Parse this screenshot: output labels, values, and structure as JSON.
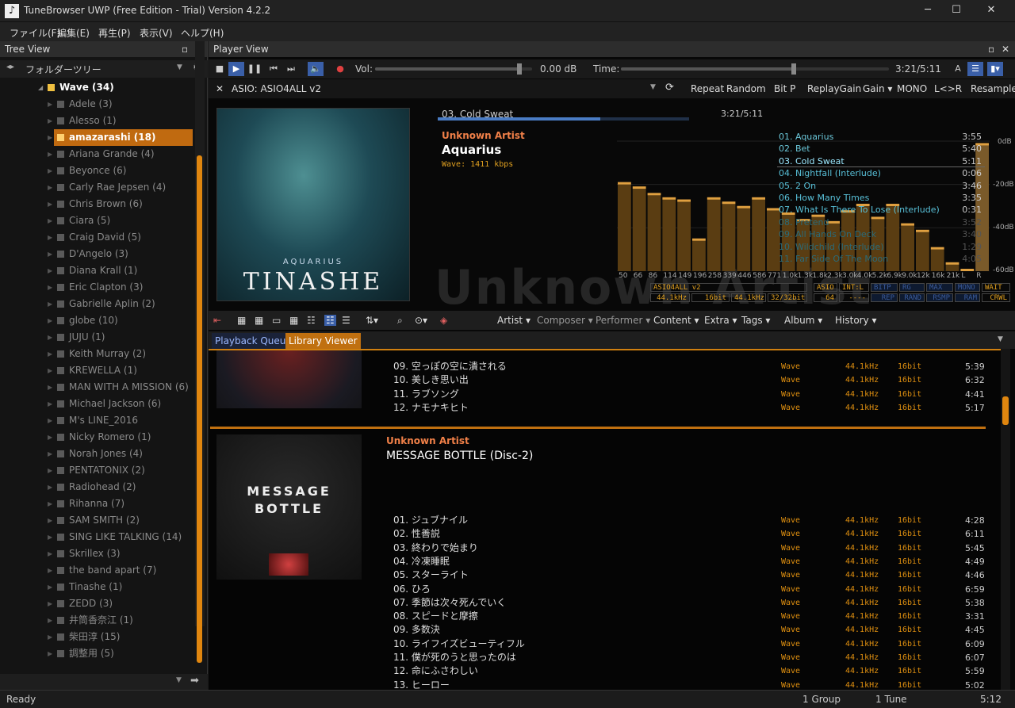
{
  "window": {
    "title": "TuneBrowser UWP (Free Edition - Trial) Version 4.2.2",
    "minimize": "─",
    "maximize": "☐",
    "close": "✕"
  },
  "menu": [
    "ファイル(F)",
    "編集(E)",
    "再生(P)",
    "表示(V)",
    "ヘルプ(H)"
  ],
  "tree": {
    "title": "Tree View",
    "mode": "フォルダーツリー",
    "root": "Wave (34)",
    "selected": "amazarashi (18)",
    "items": [
      "Adele (3)",
      "Alesso (1)",
      "amazarashi (18)",
      "Ariana Grande (4)",
      "Beyonce (6)",
      "Carly Rae Jepsen (4)",
      "Chris Brown (6)",
      "Ciara (5)",
      "Craig David (5)",
      "D'Angelo (3)",
      "Diana Krall (1)",
      "Eric Clapton (3)",
      "Gabrielle Aplin (2)",
      "globe (10)",
      "JUJU (1)",
      "Keith Murray (2)",
      "KREWELLA (1)",
      "MAN WITH A MISSION (6)",
      "Michael Jackson (6)",
      "M's LINE_2016",
      "Nicky Romero (1)",
      "Norah Jones (4)",
      "PENTATONIX (2)",
      "Radiohead (2)",
      "Rihanna (7)",
      "SAM SMITH (2)",
      "SING LIKE TALKING (14)",
      "Skrillex (3)",
      "the band apart (7)",
      "Tinashe (1)",
      "ZEDD (3)",
      "井筒香奈江 (1)",
      "柴田淳 (15)",
      "調整用 (5)"
    ]
  },
  "player": {
    "title": "Player View",
    "vol_label": "Vol:",
    "vol_value": "0.00 dB",
    "vol_level": 0.92,
    "time_label": "Time:",
    "time_value": "3:21/5:11",
    "progress": 0.646,
    "device": "ASIO: ASIO4ALL v2",
    "sub_buttons": [
      "Repeat",
      "Random",
      "Bit P",
      "ReplayGain",
      "Gain ▾",
      "MONO",
      "L<>R",
      "Resample"
    ]
  },
  "now_playing": {
    "track": "03. Cold Sweat",
    "time": "3:21/5:11",
    "artist": "Unknown Artist",
    "album": "Aquarius",
    "format": "Wave: 1411 kbps",
    "art_sub": "AQUARIUS",
    "art_main": "TINASHE",
    "bg_text": "Unknown Artist",
    "playlist": [
      {
        "title": "01. Aquarius",
        "dur": "3:55"
      },
      {
        "title": "02. Bet",
        "dur": "5:40"
      },
      {
        "title": "03. Cold Sweat",
        "dur": "5:11"
      },
      {
        "title": "04. Nightfall (Interlude)",
        "dur": "0:06"
      },
      {
        "title": "05. 2 On",
        "dur": "3:46"
      },
      {
        "title": "06. How Many Times",
        "dur": "3:35"
      },
      {
        "title": "07. What Is There To Lose (Interlude)",
        "dur": "0:31"
      },
      {
        "title": "08. Pretend",
        "dur": "3:52"
      },
      {
        "title": "09. All Hands On Deck",
        "dur": "3:40"
      },
      {
        "title": "10. Wildchild (Interlude)",
        "dur": "1:29"
      },
      {
        "title": "11. Far Side Of The Moon",
        "dur": "4:05"
      }
    ],
    "db_labels": [
      "0dB",
      "-20dB",
      "-40dB",
      "-60dB"
    ],
    "status_blocks": {
      "row1": [
        "ASIO4ALL v2",
        "ASIO",
        "INT:L",
        "BITP",
        "RG",
        "MAX",
        "MONO",
        "WAIT"
      ],
      "row2": [
        "44.1kHz",
        "16bit",
        "44.1kHz",
        "32/32bit",
        "64",
        "----",
        "REP",
        "RAND",
        "RSMP",
        "RAM",
        "CRWL"
      ]
    }
  },
  "chart_data": {
    "type": "bar",
    "title": "",
    "categories": [
      "50",
      "66",
      "86",
      "114",
      "149",
      "196",
      "258",
      "339",
      "446",
      "586",
      "771",
      "1.0k",
      "1.3k",
      "1.8k",
      "2.3k",
      "3.0k",
      "4.0k",
      "5.2k",
      "6.9k",
      "9.0k",
      "12k",
      "16k",
      "21k",
      "L",
      "R"
    ],
    "values": [
      -20,
      -22,
      -25,
      -27,
      -28,
      -46,
      -27,
      -29,
      -31,
      -27,
      -32,
      -34,
      -37,
      -35,
      -38,
      -33,
      -30,
      -36,
      -30,
      -39,
      -42,
      -50,
      -57,
      -60,
      -2
    ],
    "ylim": [
      -60,
      0
    ],
    "ylabel": ""
  },
  "library": {
    "toolbar": [
      "Artist ▾",
      "Composer ▾",
      "Performer ▾",
      "Content ▾",
      "Extra ▾",
      "Tags ▾",
      "Album ▾",
      "History ▾"
    ],
    "tabs": [
      "Playback Queue",
      "Library Viewer"
    ],
    "group1_tracks": [
      {
        "title": "09. 空っぽの空に潰される",
        "fmt": "Wave",
        "rate": "44.1kHz",
        "bits": "16bit",
        "dur": "5:39"
      },
      {
        "title": "10. 美しき思い出",
        "fmt": "Wave",
        "rate": "44.1kHz",
        "bits": "16bit",
        "dur": "6:32"
      },
      {
        "title": "11. ラブソング",
        "fmt": "Wave",
        "rate": "44.1kHz",
        "bits": "16bit",
        "dur": "4:41"
      },
      {
        "title": "12. ナモナキヒト",
        "fmt": "Wave",
        "rate": "44.1kHz",
        "bits": "16bit",
        "dur": "5:17"
      }
    ],
    "group2": {
      "artist": "Unknown Artist",
      "album": "MESSAGE BOTTLE (Disc-2)",
      "cover_line1": "MESSAGE",
      "cover_line2": "BOTTLE",
      "tracks": [
        {
          "title": "01. ジュブナイル",
          "fmt": "Wave",
          "rate": "44.1kHz",
          "bits": "16bit",
          "dur": "4:28"
        },
        {
          "title": "02. 性善説",
          "fmt": "Wave",
          "rate": "44.1kHz",
          "bits": "16bit",
          "dur": "6:11"
        },
        {
          "title": "03. 終わりで始まり",
          "fmt": "Wave",
          "rate": "44.1kHz",
          "bits": "16bit",
          "dur": "5:45"
        },
        {
          "title": "04. 冷凍睡眠",
          "fmt": "Wave",
          "rate": "44.1kHz",
          "bits": "16bit",
          "dur": "4:49"
        },
        {
          "title": "05. スターライト",
          "fmt": "Wave",
          "rate": "44.1kHz",
          "bits": "16bit",
          "dur": "4:46"
        },
        {
          "title": "06. ひろ",
          "fmt": "Wave",
          "rate": "44.1kHz",
          "bits": "16bit",
          "dur": "6:59"
        },
        {
          "title": "07. 季節は次々死んでいく",
          "fmt": "Wave",
          "rate": "44.1kHz",
          "bits": "16bit",
          "dur": "5:38"
        },
        {
          "title": "08. スピードと摩擦",
          "fmt": "Wave",
          "rate": "44.1kHz",
          "bits": "16bit",
          "dur": "3:31"
        },
        {
          "title": "09. 多数決",
          "fmt": "Wave",
          "rate": "44.1kHz",
          "bits": "16bit",
          "dur": "4:45"
        },
        {
          "title": "10. ライフイズビューティフル",
          "fmt": "Wave",
          "rate": "44.1kHz",
          "bits": "16bit",
          "dur": "6:09"
        },
        {
          "title": "11. 僕が死のうと思ったのは",
          "fmt": "Wave",
          "rate": "44.1kHz",
          "bits": "16bit",
          "dur": "6:07"
        },
        {
          "title": "12. 命にふさわしい",
          "fmt": "Wave",
          "rate": "44.1kHz",
          "bits": "16bit",
          "dur": "5:59"
        },
        {
          "title": "13. ヒーロー",
          "fmt": "Wave",
          "rate": "44.1kHz",
          "bits": "16bit",
          "dur": "5:02"
        }
      ]
    }
  },
  "status": {
    "ready": "Ready",
    "groups": "1 Group",
    "tunes": "1 Tune",
    "clock": "5:12"
  },
  "colors": {
    "accent": "#e0860f",
    "artist": "#f08048",
    "current_track": "#ffffff",
    "played": "#6bc7d9"
  }
}
